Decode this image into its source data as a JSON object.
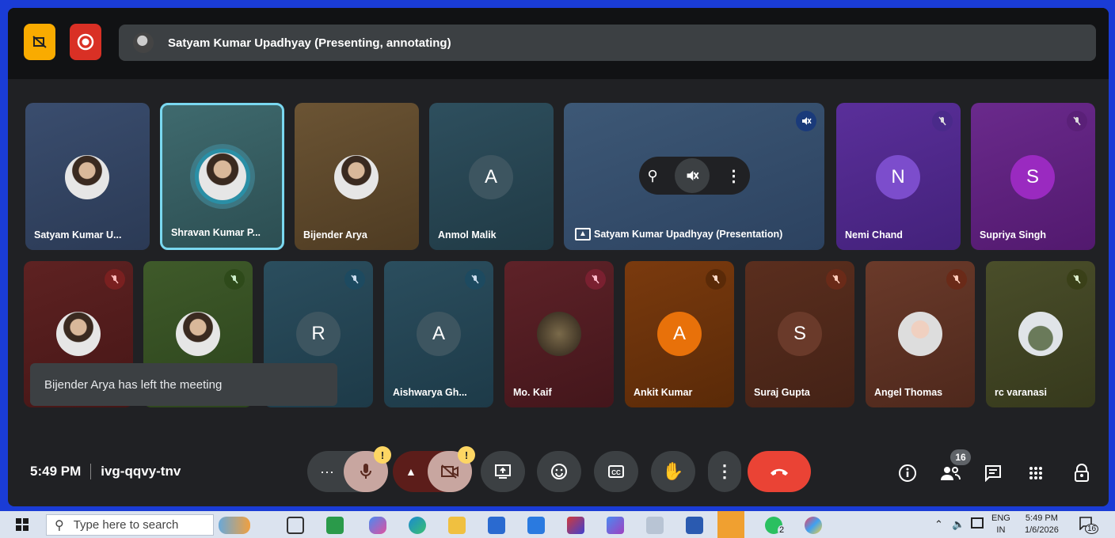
{
  "top": {
    "presenter_text": "Satyam Kumar Upadhyay (Presenting, annotating)"
  },
  "tiles_row1": [
    {
      "name": "Satyam Kumar U...",
      "avatar": ""
    },
    {
      "name": "Shravan Kumar P...",
      "avatar": ""
    },
    {
      "name": "Bijender Arya",
      "avatar": ""
    },
    {
      "name": "Anmol Malik",
      "avatar": "A"
    },
    {
      "name": "Satyam Kumar Upadhyay (Presentation)",
      "avatar": ""
    },
    {
      "name": "Nemi Chand",
      "avatar": "N"
    },
    {
      "name": "Supriya Singh",
      "avatar": "S"
    }
  ],
  "tiles_row2": [
    {
      "name": "",
      "avatar": ""
    },
    {
      "name": "",
      "avatar": ""
    },
    {
      "name": "",
      "avatar": "R"
    },
    {
      "name": "Aishwarya Gh...",
      "avatar": "A"
    },
    {
      "name": "Mo. Kaif",
      "avatar": ""
    },
    {
      "name": "Ankit Kumar",
      "avatar": "A"
    },
    {
      "name": "Suraj Gupta",
      "avatar": "S"
    },
    {
      "name": "Angel Thomas",
      "avatar": ""
    },
    {
      "name": "rc varanasi",
      "avatar": ""
    }
  ],
  "toast": "Bijender Arya has left the meeting",
  "meeting": {
    "time": "5:49 PM",
    "code": "ivg-qqvy-tnv"
  },
  "controls": {
    "mic_badge": "!",
    "cam_badge": "!",
    "people_count": "16"
  },
  "taskbar": {
    "search_placeholder": "Type here to search",
    "lang_line1": "ENG",
    "lang_line2": "IN",
    "time": "5:49 PM",
    "date": "1/6/2026",
    "notifications": "16",
    "whatsapp_count": "2"
  },
  "colors": {
    "accent_red": "#ea4335",
    "highlight_border": "#7ad8f0",
    "warning": "#fdd663"
  }
}
